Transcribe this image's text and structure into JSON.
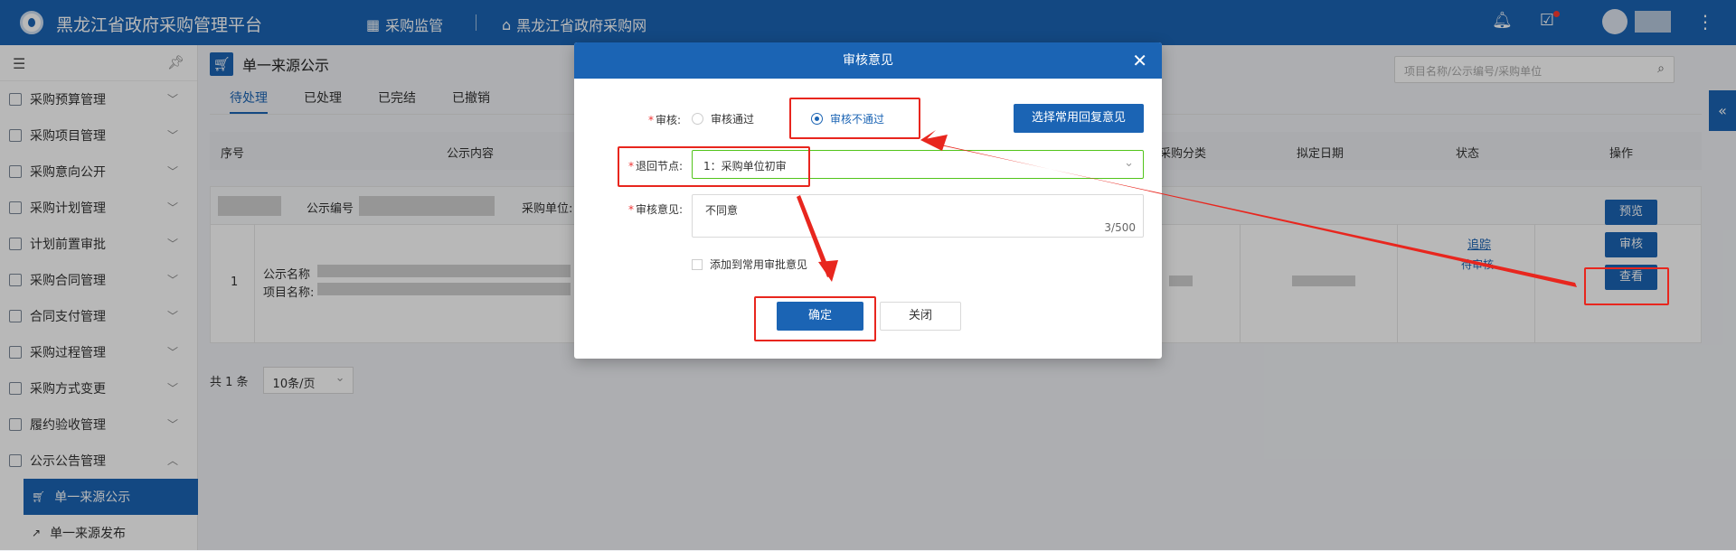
{
  "header": {
    "app_title": "黑龙江省政府采购管理平台",
    "nav": [
      {
        "label": "采购监管",
        "icon": "grid-icon"
      },
      {
        "label": "黑龙江省政府采购网",
        "icon": "home-icon"
      }
    ],
    "icons": [
      "bell-icon",
      "task-icon",
      "avatar",
      "more-icon"
    ]
  },
  "sidebar": {
    "items": [
      {
        "label": "采购预算管理"
      },
      {
        "label": "采购项目管理"
      },
      {
        "label": "采购意向公开"
      },
      {
        "label": "采购计划管理"
      },
      {
        "label": "计划前置审批"
      },
      {
        "label": "采购合同管理"
      },
      {
        "label": "合同支付管理"
      },
      {
        "label": "采购过程管理"
      },
      {
        "label": "采购方式变更"
      },
      {
        "label": "履约验收管理"
      },
      {
        "label": "公示公告管理"
      }
    ],
    "sub_items": [
      {
        "label": "单一来源公示",
        "active": true
      },
      {
        "label": "单一来源发布",
        "active": false
      }
    ]
  },
  "page": {
    "title": "单一来源公示",
    "tabs": [
      "待处理",
      "已处理",
      "已完结",
      "已撤销"
    ],
    "search_placeholder": "项目名称/公示编号/采购单位"
  },
  "table": {
    "headers": [
      "序号",
      "公示内容",
      "采购分类",
      "拟定日期",
      "状态",
      "操作"
    ],
    "group_labels": {
      "notice_no": "公示编号",
      "unit": "采购单位: 黑"
    },
    "row": {
      "index": "1",
      "notice_name_label": "公示名称",
      "project_name_label": "项目名称:",
      "trace": "追踪",
      "status": "待审核",
      "actions": [
        "预览",
        "审核",
        "查看"
      ]
    }
  },
  "pager": {
    "total": "共 1 条",
    "page_size": "10条/页"
  },
  "modal": {
    "title": "审核意见",
    "review_label": "审核:",
    "radio_pass": "审核通过",
    "radio_reject": "审核不通过",
    "common_btn": "选择常用回复意见",
    "return_label": "退回节点:",
    "return_value": "1：采购单位初审",
    "opinion_label": "审核意见:",
    "opinion_value": "不同意",
    "opinion_count": "3/500",
    "add_common": "添加到常用审批意见",
    "ok": "确定",
    "close": "关闭"
  },
  "colors": {
    "primary": "#1b64b4",
    "annotation": "#e8261e",
    "valid_border": "#52c41a"
  }
}
